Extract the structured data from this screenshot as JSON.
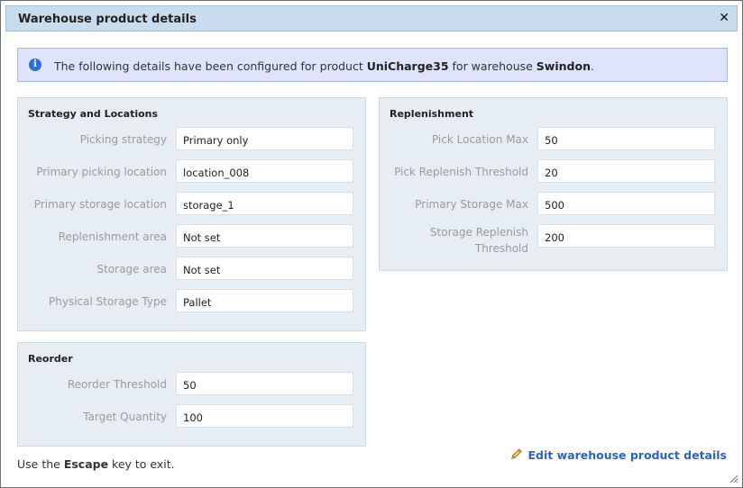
{
  "dialog": {
    "title": "Warehouse product details",
    "close_glyph": "✕"
  },
  "info": {
    "icon": "info-icon",
    "prefix": "The following details have been configured for product ",
    "product": "UniCharge35",
    "middle": " for warehouse ",
    "warehouse": "Swindon",
    "suffix": "."
  },
  "strategy": {
    "title": "Strategy and Locations",
    "rows": [
      {
        "label": "Picking strategy",
        "value": "Primary only"
      },
      {
        "label": "Primary picking location",
        "value": "location_008"
      },
      {
        "label": "Primary storage location",
        "value": "storage_1"
      },
      {
        "label": "Replenishment area",
        "value": "Not set"
      },
      {
        "label": "Storage area",
        "value": "Not set"
      },
      {
        "label": "Physical Storage Type",
        "value": "Pallet"
      }
    ]
  },
  "reorder": {
    "title": "Reorder",
    "rows": [
      {
        "label": "Reorder Threshold",
        "value": "50"
      },
      {
        "label": "Target Quantity",
        "value": "100"
      }
    ]
  },
  "replenishment": {
    "title": "Replenishment",
    "rows": [
      {
        "label": "Pick Location Max",
        "value": "50"
      },
      {
        "label": "Pick Replenish Threshold",
        "value": "20"
      },
      {
        "label": "Primary Storage Max",
        "value": "500"
      },
      {
        "label_line1": "Storage Replenish",
        "label_line2": "Threshold",
        "value": "200"
      }
    ]
  },
  "footer": {
    "prefix": "Use the ",
    "key": "Escape",
    "suffix": " key to exit."
  },
  "edit_link": {
    "icon": "pencil-icon",
    "label": "Edit warehouse product details"
  }
}
